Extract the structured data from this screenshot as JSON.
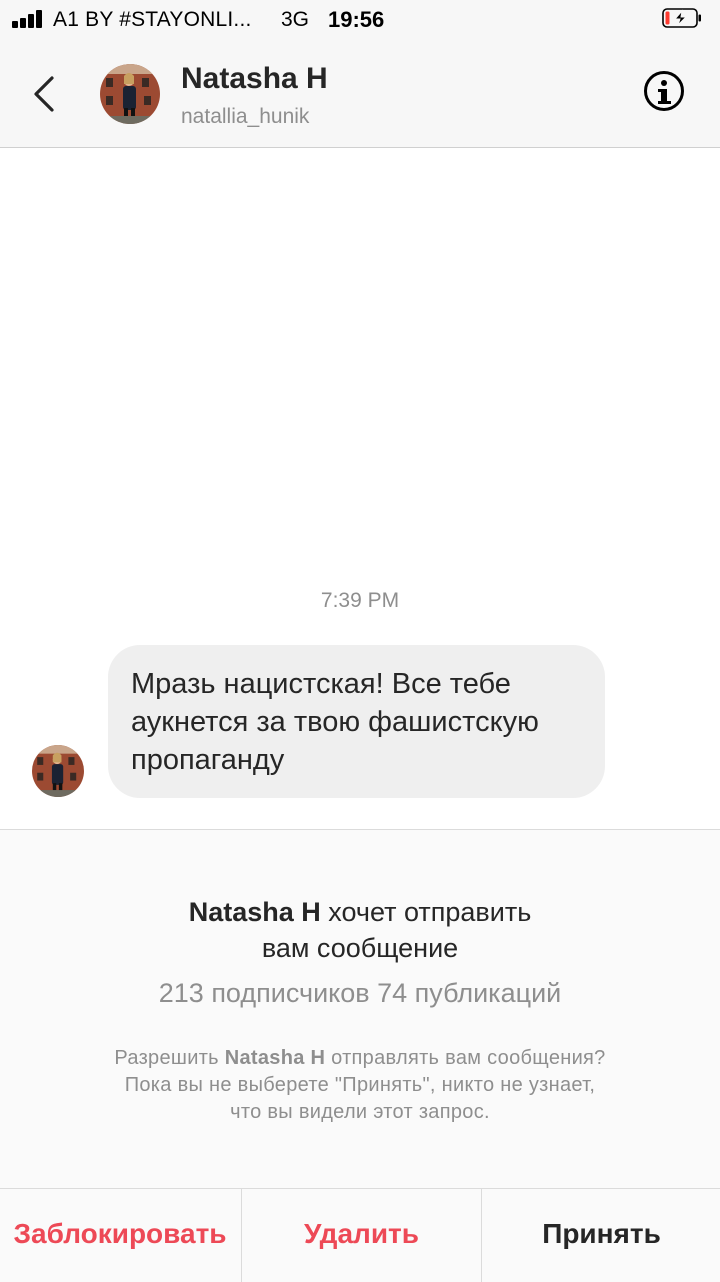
{
  "status_bar": {
    "carrier": "A1 BY #STAYONLI...",
    "network": "3G",
    "time": "19:56",
    "icons": [
      "signal-icon",
      "battery-charging-icon"
    ]
  },
  "header": {
    "name": "Natasha H",
    "username": "natallia_hunik",
    "icons": [
      "back-chevron-icon",
      "info-icon"
    ]
  },
  "chat": {
    "timestamp": "7:39 PM",
    "message": {
      "lines": [
        "Мразь нацистская! Все тебе",
        "аукнется за твою фашистскую",
        "пропаганду"
      ]
    }
  },
  "request": {
    "title_name": "Natasha H",
    "title_line1_rest": " хочет отправить",
    "title_line2": "вам сообщение",
    "stats": "213 подписчиков 74 публикаций",
    "body_line1_prefix": "Разрешить ",
    "body_line1_name": "Natasha H",
    "body_line1_suffix": " отправлять вам сообщения?",
    "body_line2": "Пока вы не выберете \"Принять\", никто не узнает,",
    "body_line3": "что вы видели этот запрос."
  },
  "actions": {
    "block": "Заблокировать",
    "delete": "Удалить",
    "accept": "Принять"
  },
  "colors": {
    "accent_red": "#ed4956",
    "bubble": "#efefef",
    "secondary_text": "#8e8e8e"
  }
}
